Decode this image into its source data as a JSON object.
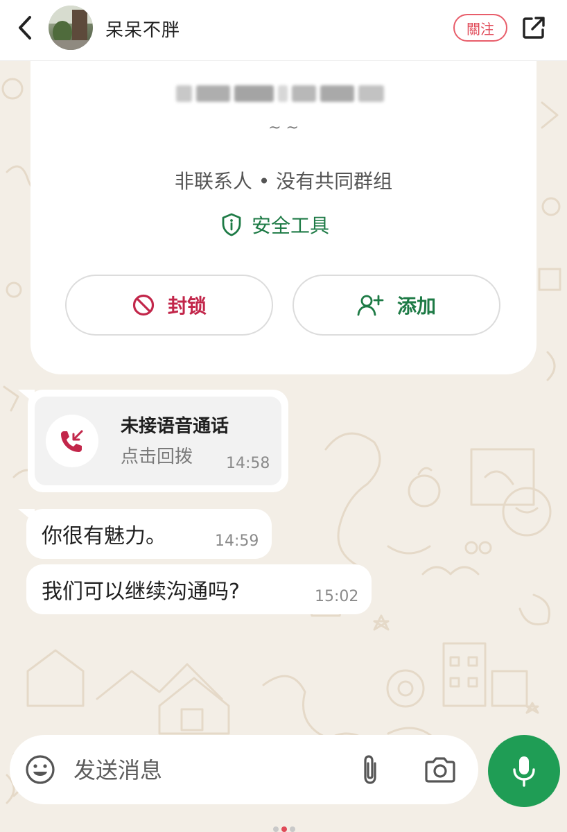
{
  "header": {
    "username": "呆呆不胖",
    "follow_label": "關注",
    "icons": {
      "back": "chevron-left-icon",
      "share": "share-external-icon"
    }
  },
  "contact_card": {
    "name_blurred": true,
    "tilde": "~ ~",
    "meta": "非联系人 • 没有共同群组",
    "safety_label": "安全工具",
    "block_label": "封锁",
    "add_label": "添加",
    "colors": {
      "block": "#c2264a",
      "accent": "#1d7a45"
    }
  },
  "messages": {
    "missed_call": {
      "title": "未接语音通话",
      "subtitle": "点击回拨",
      "time": "14:58"
    },
    "msg1": {
      "text": "你很有魅力。",
      "time": "14:59"
    },
    "msg2": {
      "text": "我们可以继续沟通吗?",
      "time": "15:02"
    }
  },
  "composer": {
    "placeholder": "发送消息",
    "mic_color": "#1f9d55"
  }
}
